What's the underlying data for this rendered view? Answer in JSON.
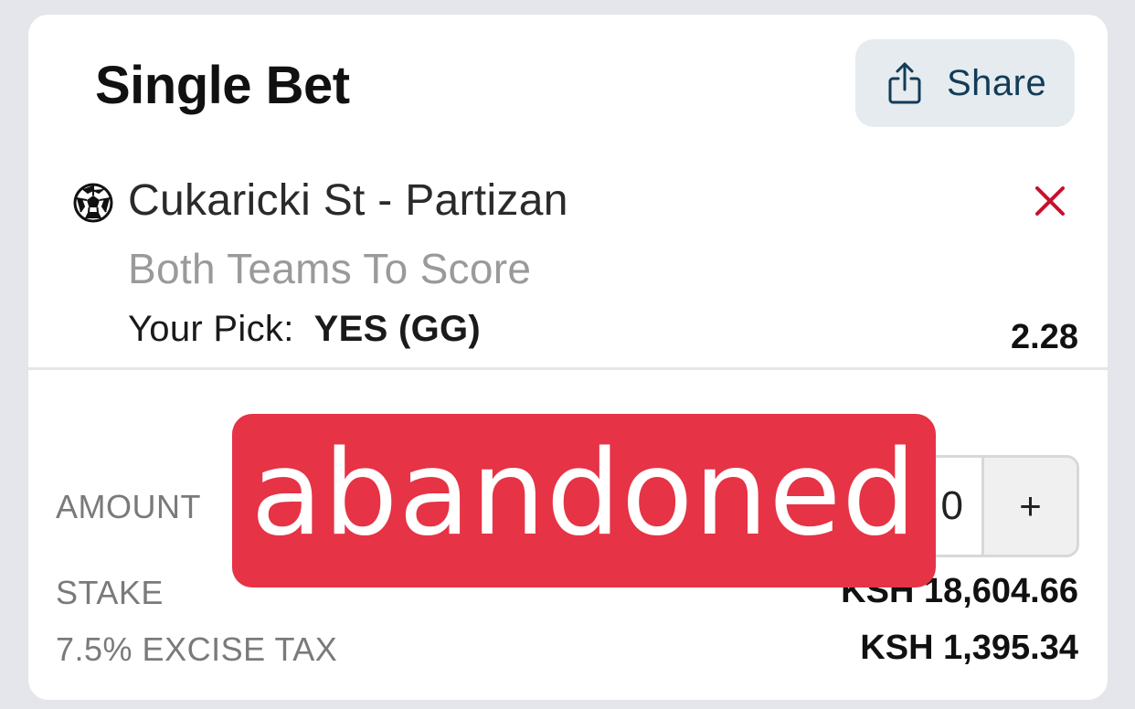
{
  "header": {
    "title": "Single Bet",
    "share_label": "Share",
    "share_icon": "share-icon"
  },
  "selection": {
    "sport_icon": "soccer-ball-icon",
    "event": "Cukaricki St - Partizan",
    "market": "Both Teams To Score",
    "pick_label": "Your Pick:",
    "pick_value": "YES (GG)",
    "odds": "2.28",
    "remove_icon": "close-icon"
  },
  "bet": {
    "amount_label": "AMOUNT",
    "amount_value": "0",
    "increment_label": "+",
    "stake_label": "STAKE",
    "stake_value": "KSH 18,604.66",
    "tax_label": "7.5% EXCISE TAX",
    "tax_value": "KSH 1,395.34"
  },
  "overlay": {
    "stamp_text": "abandoned",
    "stamp_color": "#e63345"
  },
  "colors": {
    "share_bg": "#e5ebee",
    "share_text": "#123b58",
    "remove_red": "#c8102e"
  }
}
